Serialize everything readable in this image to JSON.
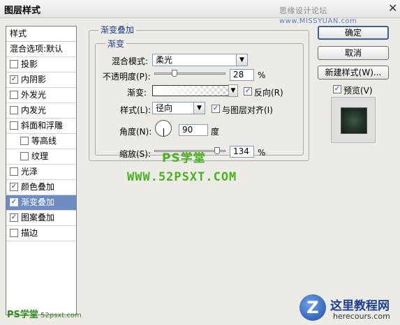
{
  "window": {
    "title": "图层样式",
    "watermark_top_cn": "思缘设计论坛",
    "watermark_top_url": "www.MISSYUAN.com",
    "close_glyph": "✕"
  },
  "sidebar": {
    "header": "样式",
    "blend_options": "混合选项:默认",
    "items": [
      {
        "label": "投影",
        "checked": false,
        "glyph": ""
      },
      {
        "label": "内阴影",
        "checked": true,
        "glyph": "✓"
      },
      {
        "label": "外发光",
        "checked": false,
        "glyph": ""
      },
      {
        "label": "内发光",
        "checked": false,
        "glyph": ""
      },
      {
        "label": "斜面和浮雕",
        "checked": false,
        "glyph": ""
      },
      {
        "label": "等高线",
        "checked": false,
        "glyph": ""
      },
      {
        "label": "纹理",
        "checked": false,
        "glyph": ""
      },
      {
        "label": "光泽",
        "checked": false,
        "glyph": ""
      },
      {
        "label": "颜色叠加",
        "checked": true,
        "glyph": "✓"
      },
      {
        "label": "渐变叠加",
        "checked": true,
        "glyph": "✓"
      },
      {
        "label": "图案叠加",
        "checked": true,
        "glyph": "✓"
      },
      {
        "label": "描边",
        "checked": false,
        "glyph": ""
      }
    ]
  },
  "panel": {
    "group_title": "渐变叠加",
    "sub_title": "渐变",
    "blend_mode_label": "混合模式:",
    "blend_mode_value": "柔光",
    "opacity_label": "不透明度(P):",
    "opacity_value": "28",
    "opacity_unit": "%",
    "opacity_level": 0.28,
    "gradient_label": "渐变:",
    "reverse_label": "反向(R)",
    "reverse_checked": "✓",
    "style_label": "样式(L):",
    "style_value": "径向",
    "align_label": "与图层对齐(I)",
    "align_checked": "✓",
    "angle_label": "角度(N):",
    "angle_value": "90",
    "angle_unit": "度",
    "scale_label": "缩放(S):",
    "scale_value": "134",
    "scale_unit": "%"
  },
  "buttons": {
    "ok": "确定",
    "cancel": "取消",
    "new_style": "新建样式(W)...",
    "preview_label": "预览(V)",
    "preview_checked": "✓"
  },
  "watermarks": {
    "ps_center": "PS学堂",
    "url_center": "WWW.52PSXT.COM",
    "bottom_left_big": "PS学堂",
    "bottom_left_small": "52psxt.com",
    "logo_letter": "Z",
    "logo_title": "这里教程网",
    "logo_url": "herecours.com"
  },
  "colors": {
    "accent_selected": "#6e8bc2",
    "watermark_green": "#49b31f",
    "logo_blue": "#1e3f93"
  }
}
